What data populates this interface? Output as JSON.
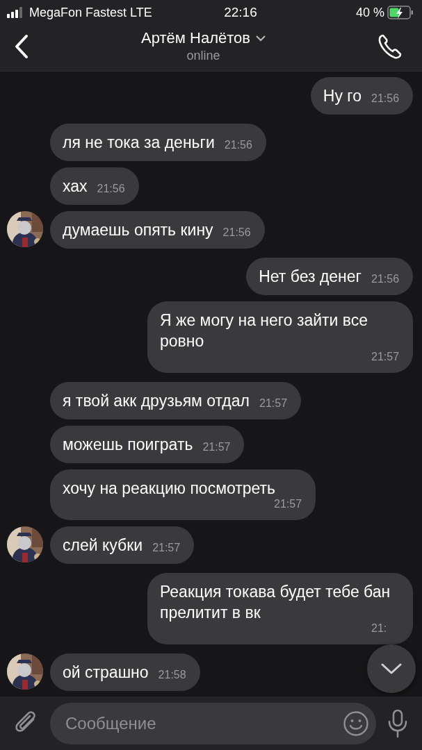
{
  "status_bar": {
    "carrier": "MegaFon Fastest LTE",
    "time": "22:16",
    "battery": "40 %",
    "charging": true
  },
  "header": {
    "name": "Артём Налётов",
    "status": "online"
  },
  "messages": [
    {
      "kind": "outgoing",
      "text": "Ну го",
      "time": "21:56",
      "avatar": false
    },
    {
      "kind": "incoming",
      "text": "ля не тока за деньги",
      "time": "21:56",
      "avatar": false
    },
    {
      "kind": "incoming",
      "text": "хах",
      "time": "21:56",
      "avatar": false
    },
    {
      "kind": "incoming",
      "text": "думаешь опять кину",
      "time": "21:56",
      "avatar": true
    },
    {
      "kind": "outgoing",
      "text": "Нет без денег",
      "time": "21:56",
      "avatar": false
    },
    {
      "kind": "outgoing",
      "text": "Я же могу на него зайти все ровно",
      "time": "21:57",
      "avatar": false
    },
    {
      "kind": "incoming",
      "text": "я твой акк друзьям отдал",
      "time": "21:57",
      "avatar": false
    },
    {
      "kind": "incoming",
      "text": "можешь поиграть",
      "time": "21:57",
      "avatar": false
    },
    {
      "kind": "incoming",
      "text": "хочу на реакцию посмотреть",
      "time": "21:57",
      "avatar": false
    },
    {
      "kind": "incoming",
      "text": "слей кубки",
      "time": "21:57",
      "avatar": true
    },
    {
      "kind": "outgoing",
      "text": "Реакция токава будет тебе бан прелитит в вк",
      "time": "21:",
      "avatar": false
    },
    {
      "kind": "incoming",
      "text": "ой страшно",
      "time": "21:58",
      "avatar": true
    }
  ],
  "composer": {
    "placeholder": "Сообщение"
  }
}
